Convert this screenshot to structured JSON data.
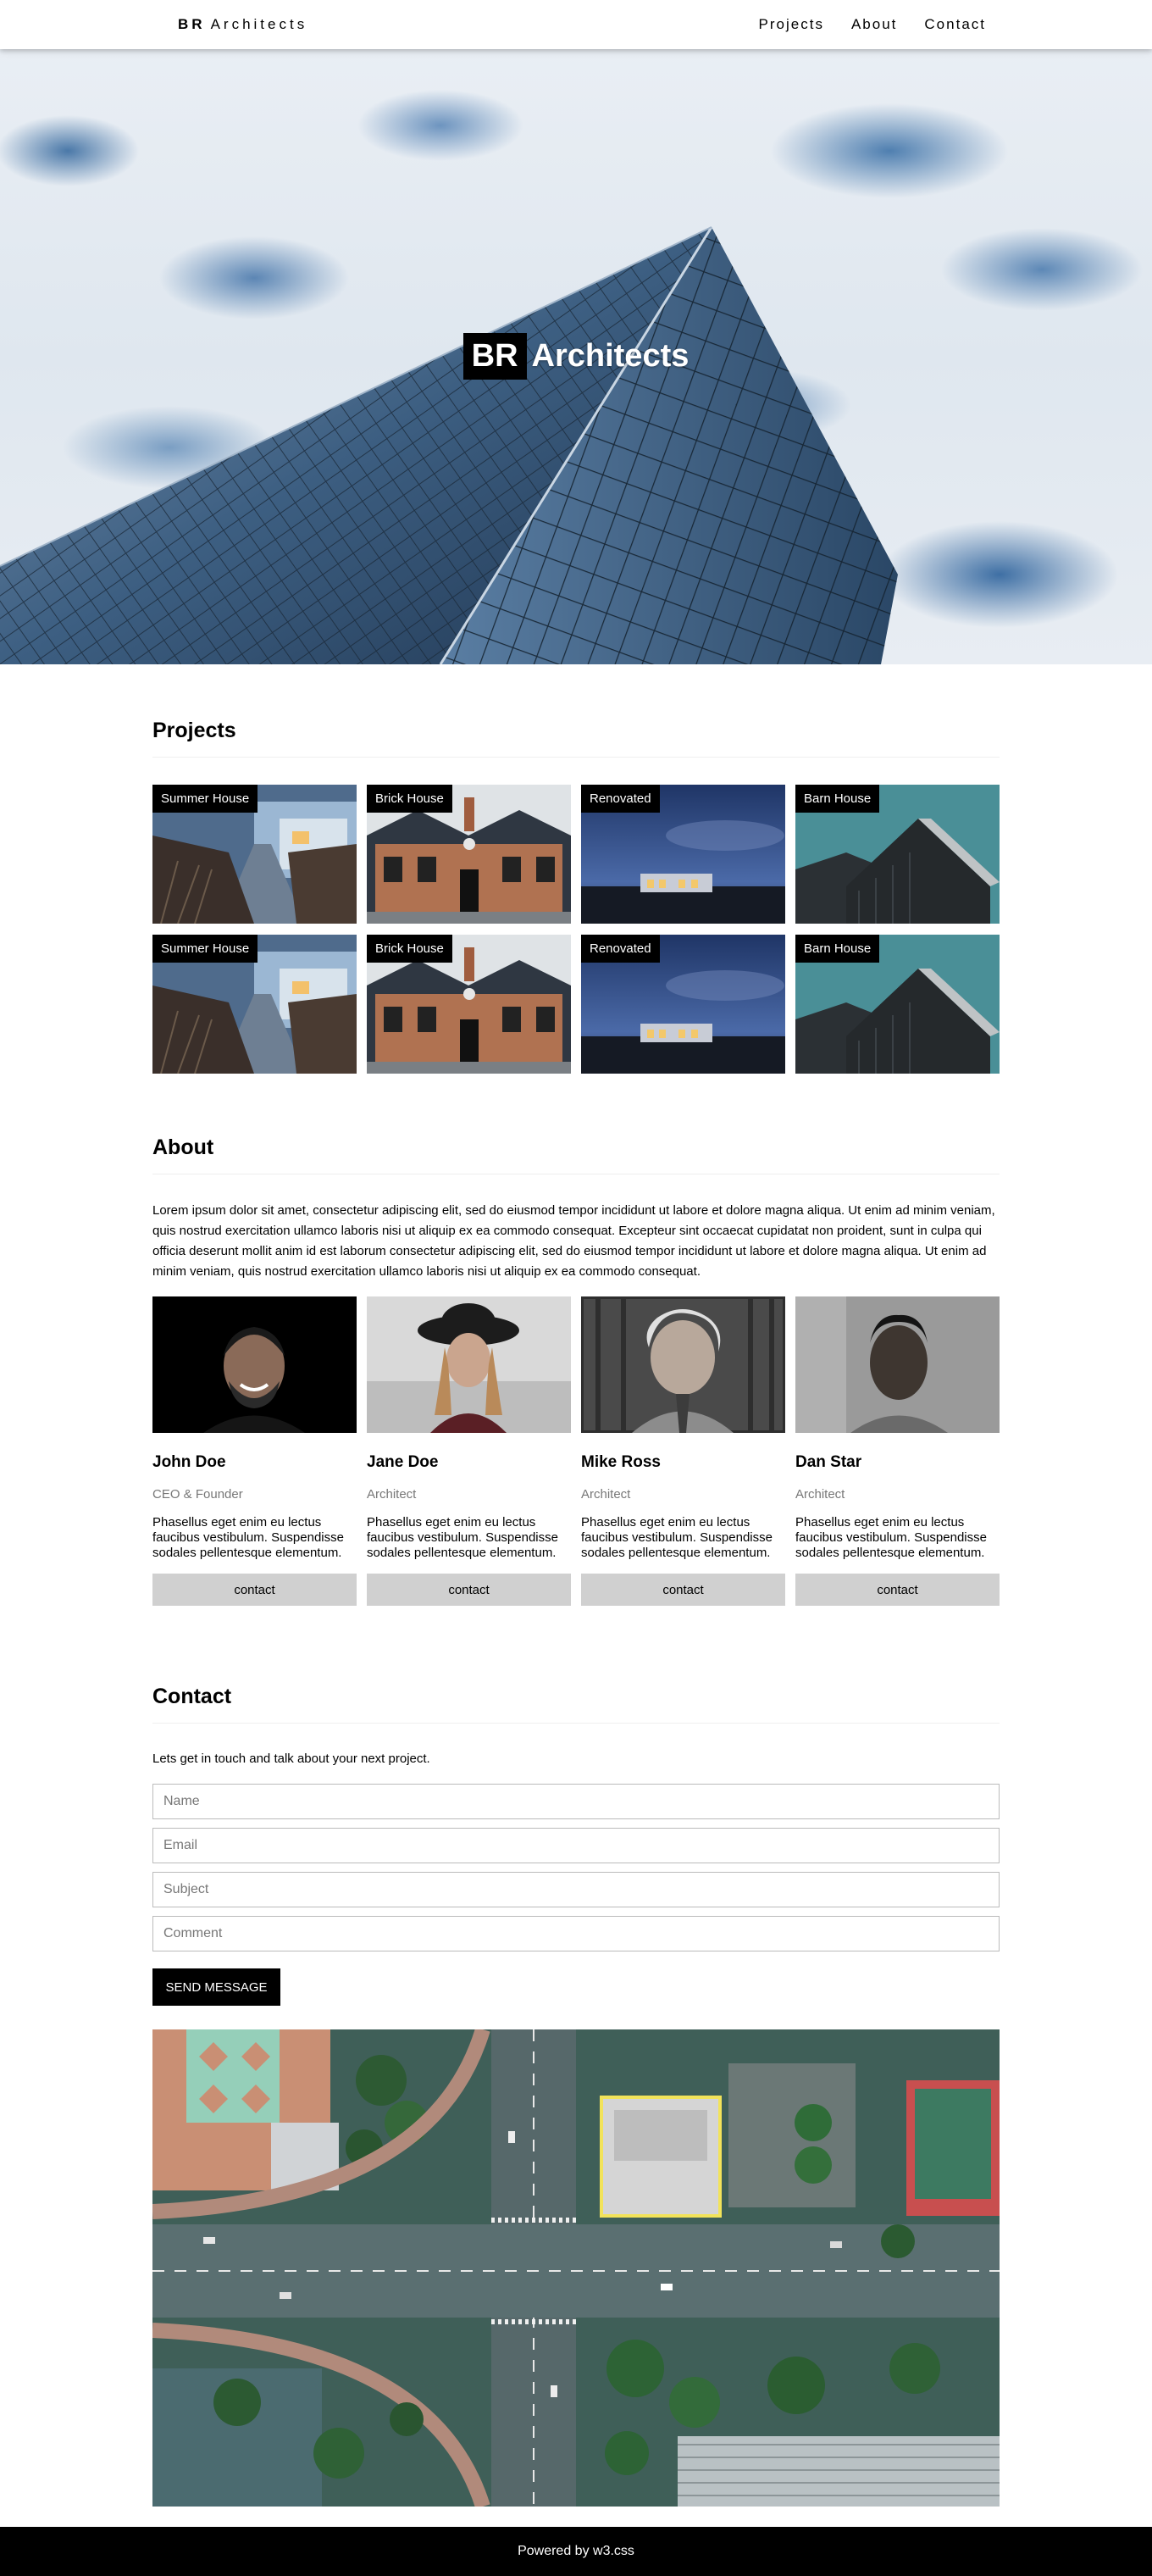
{
  "nav": {
    "brand_bold": "BR",
    "brand_rest": "Architects",
    "links": [
      "Projects",
      "About",
      "Contact"
    ]
  },
  "hero": {
    "title_box": "BR",
    "title_rest": "Architects"
  },
  "projects": {
    "heading": "Projects",
    "items": [
      "Summer House",
      "Brick House",
      "Renovated",
      "Barn House",
      "Summer House",
      "Brick House",
      "Renovated",
      "Barn House"
    ]
  },
  "about": {
    "heading": "About",
    "text": "Lorem ipsum dolor sit amet, consectetur adipiscing elit, sed do eiusmod tempor incididunt ut labore et dolore magna aliqua. Ut enim ad minim veniam, quis nostrud exercitation ullamco laboris nisi ut aliquip ex ea commodo consequat. Excepteur sint occaecat cupidatat non proident, sunt in culpa qui officia deserunt mollit anim id est laborum consectetur adipiscing elit, sed do eiusmod tempor incididunt ut labore et dolore magna aliqua. Ut enim ad minim veniam, quis nostrud exercitation ullamco laboris nisi ut aliquip ex ea commodo consequat.",
    "team": [
      {
        "name": "John Doe",
        "role": "CEO & Founder",
        "desc": "Phasellus eget enim eu lectus faucibus vestibulum. Suspendisse sodales pellentesque elementum.",
        "button": "contact"
      },
      {
        "name": "Jane Doe",
        "role": "Architect",
        "desc": "Phasellus eget enim eu lectus faucibus vestibulum. Suspendisse sodales pellentesque elementum.",
        "button": "contact"
      },
      {
        "name": "Mike Ross",
        "role": "Architect",
        "desc": "Phasellus eget enim eu lectus faucibus vestibulum. Suspendisse sodales pellentesque elementum.",
        "button": "contact"
      },
      {
        "name": "Dan Star",
        "role": "Architect",
        "desc": "Phasellus eget enim eu lectus faucibus vestibulum. Suspendisse sodales pellentesque elementum.",
        "button": "contact"
      }
    ]
  },
  "contact": {
    "heading": "Contact",
    "lead": "Lets get in touch and talk about your next project.",
    "placeholders": {
      "name": "Name",
      "email": "Email",
      "subject": "Subject",
      "comment": "Comment"
    },
    "send_label": "SEND MESSAGE"
  },
  "footer": {
    "text": "Powered by w3.css"
  },
  "colors": {
    "accent": "#000000",
    "button_grey": "#d0d0d0",
    "muted_text": "#777777"
  }
}
